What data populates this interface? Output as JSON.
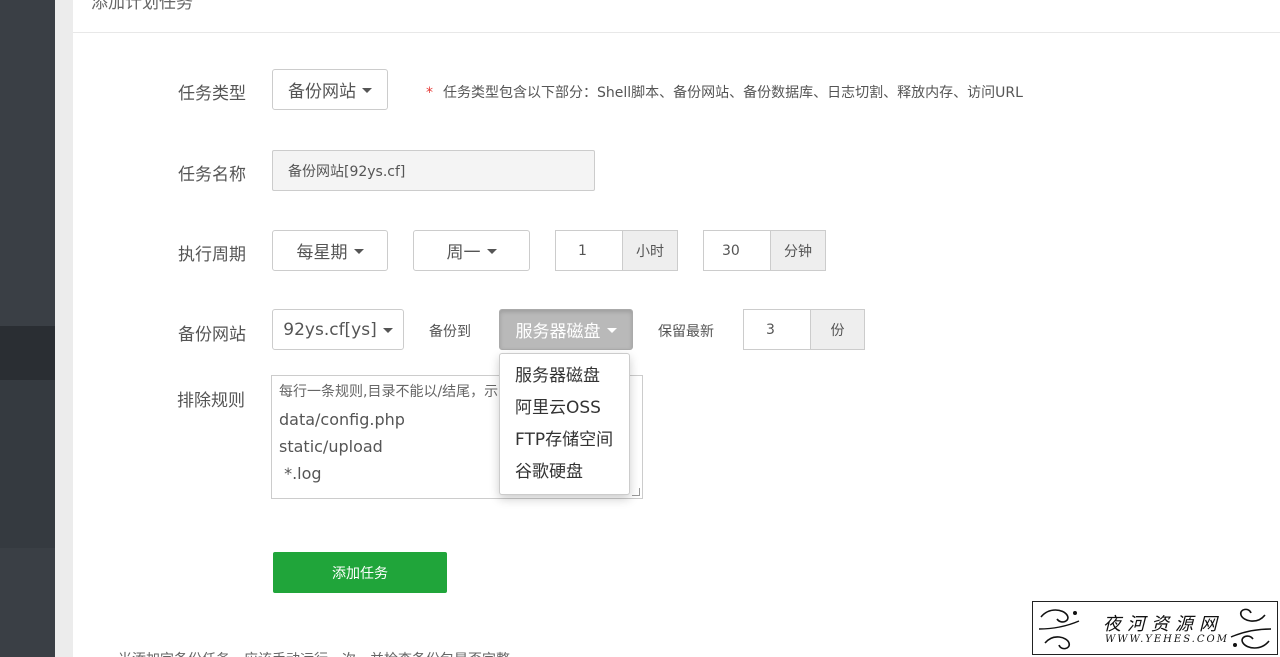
{
  "panel": {
    "title": "添加计划任务"
  },
  "form": {
    "task_type": {
      "label": "任务类型",
      "value": "备份网站",
      "note_star": "*",
      "note": "任务类型包含以下部分：Shell脚本、备份网站、备份数据库、日志切割、释放内存、访问URL"
    },
    "task_name": {
      "label": "任务名称",
      "value": "备份网站[92ys.cf]"
    },
    "cycle": {
      "label": "执行周期",
      "period": "每星期",
      "weekday": "周一",
      "hour": "1",
      "hour_unit": "小时",
      "minute": "30",
      "minute_unit": "分钟"
    },
    "backup_site": {
      "label": "备份网站",
      "site": "92ys.cf[ys]",
      "backup_to_label": "备份到",
      "backup_to": "服务器磁盘",
      "keep_label": "保留最新",
      "keep_value": "3",
      "keep_unit": "份"
    },
    "exclude": {
      "label": "排除规则",
      "hint": "每行一条规则,目录不能以/结尾，示",
      "lines": [
        "data/config.php",
        "static/upload",
        " *.log"
      ]
    },
    "submit_label": "添加任务"
  },
  "dropdown": {
    "options": [
      "服务器磁盘",
      "阿里云OSS",
      "FTP存储空间",
      "谷歌硬盘"
    ]
  },
  "footer_note": "当添加完备份任务，应该手动运行一次，并检查备份包是否完整",
  "watermark": {
    "text": "夜河资源网",
    "url": "WWW.YEHES.COM"
  },
  "colors": {
    "primary_green": "#20a53a",
    "sidebar": "#3a3f45"
  }
}
